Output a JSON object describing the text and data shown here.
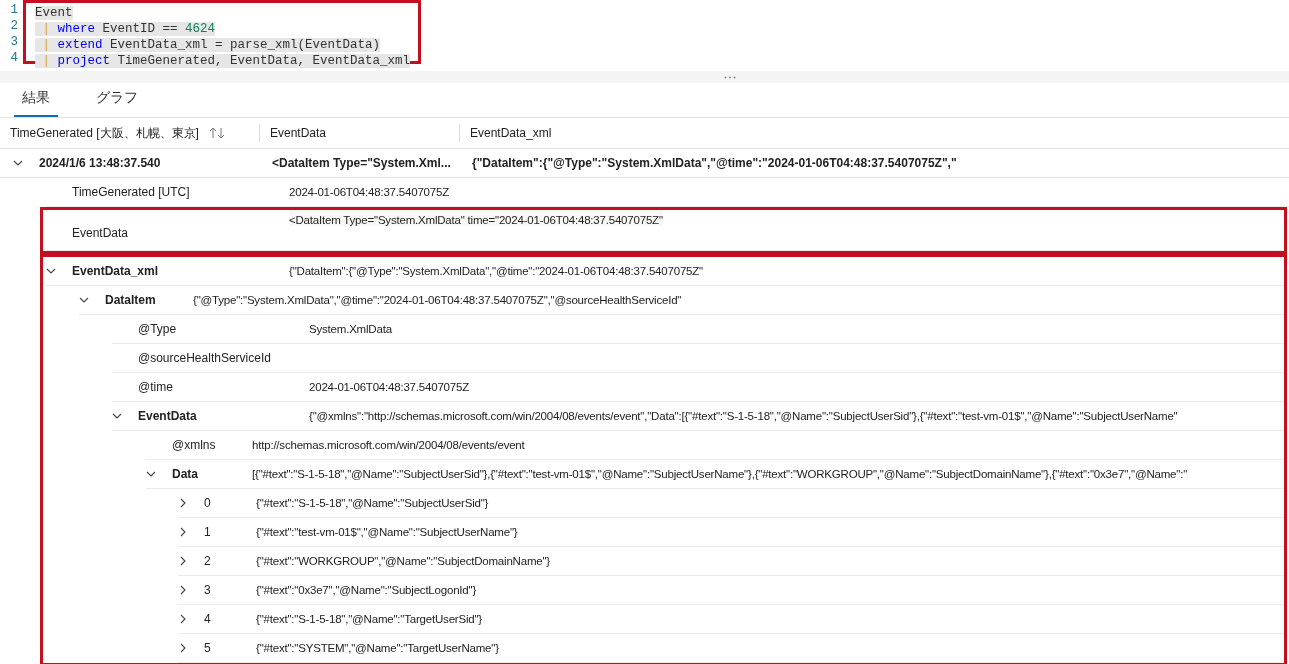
{
  "editor": {
    "highlighted": true,
    "lines": [
      {
        "number": "1",
        "tokens": [
          {
            "kind": "plain",
            "text": "Event"
          }
        ]
      },
      {
        "number": "2",
        "tokens": [
          {
            "kind": "pipe",
            "text": " | "
          },
          {
            "kind": "keyword",
            "text": "where"
          },
          {
            "kind": "plain",
            "text": " EventID == "
          },
          {
            "kind": "number",
            "text": "4624"
          }
        ]
      },
      {
        "number": "3",
        "tokens": [
          {
            "kind": "pipe",
            "text": " | "
          },
          {
            "kind": "keyword",
            "text": "extend"
          },
          {
            "kind": "plain",
            "text": " EventData_xml = parse_xml(EventData)"
          }
        ]
      },
      {
        "number": "4",
        "tokens": [
          {
            "kind": "pipe",
            "text": " | "
          },
          {
            "kind": "keyword",
            "text": "project"
          },
          {
            "kind": "plain",
            "text": " TimeGenerated, EventData, EventData_xml"
          }
        ]
      }
    ]
  },
  "tabs": [
    {
      "label": "結果",
      "selected": true
    },
    {
      "label": "グラフ",
      "selected": false
    }
  ],
  "table": {
    "columns": [
      {
        "label": "TimeGenerated [大阪、札幌、東京]",
        "sortable": true
      },
      {
        "label": "EventData",
        "sortable": false
      },
      {
        "label": "EventData_xml",
        "sortable": false
      }
    ],
    "rows": [
      {
        "expanded": true,
        "cells": [
          "2024/1/6 13:48:37.540",
          "<DataItem Type=\"System.Xml...",
          "{\"DataItem\":{\"@Type\":\"System.XmlData\",\"@time\":\"2024-01-06T04:48:37.5407075Z\",\""
        ],
        "details": [
          {
            "key": "TimeGenerated [UTC]",
            "value": "2024-01-06T04:48:37.5407075Z"
          },
          {
            "key": "EventData",
            "value": "<DataItem Type=\"System.XmlData\" time=\"2024-01-06T04:48:37.5407075Z\"",
            "highlighted": true
          },
          {
            "key": "EventData_xml",
            "value": "{\"DataItem\":{\"@Type\":\"System.XmlData\",\"@time\":\"2024-01-06T04:48:37.5407075Z\"",
            "highlighted": true,
            "expanded": true,
            "children": [
              {
                "key": "DataItem",
                "value": "{\"@Type\":\"System.XmlData\",\"@time\":\"2024-01-06T04:48:37.5407075Z\",\"@sourceHealthServiceId\"",
                "expanded": true,
                "children": [
                  {
                    "key": "@Type",
                    "value": "System.XmlData"
                  },
                  {
                    "key": "@sourceHealthServiceId"
                  },
                  {
                    "key": "@time",
                    "value": "2024-01-06T04:48:37.5407075Z"
                  },
                  {
                    "key": "EventData",
                    "value": "{\"@xmlns\":\"http://schemas.microsoft.com/win/2004/08/events/event\",\"Data\":[{\"#text\":\"S-1-5-18\",\"@Name\":\"SubjectUserSid\"},{\"#text\":\"test-vm-01$\",\"@Name\":\"SubjectUserName\"",
                    "expanded": true,
                    "children": [
                      {
                        "key": "@xmlns",
                        "value": "http://schemas.microsoft.com/win/2004/08/events/event"
                      },
                      {
                        "key": "Data",
                        "value": "[{\"#text\":\"S-1-5-18\",\"@Name\":\"SubjectUserSid\"},{\"#text\":\"test-vm-01$\",\"@Name\":\"SubjectUserName\"},{\"#text\":\"WORKGROUP\",\"@Name\":\"SubjectDomainName\"},{\"#text\":\"0x3e7\",\"@Name\":\"",
                        "expanded": true,
                        "children": [
                          {
                            "key": "0",
                            "value": "{\"#text\":\"S-1-5-18\",\"@Name\":\"SubjectUserSid\"}",
                            "expanded": false
                          },
                          {
                            "key": "1",
                            "value": "{\"#text\":\"test-vm-01$\",\"@Name\":\"SubjectUserName\"}",
                            "expanded": false
                          },
                          {
                            "key": "2",
                            "value": "{\"#text\":\"WORKGROUP\",\"@Name\":\"SubjectDomainName\"}",
                            "expanded": false
                          },
                          {
                            "key": "3",
                            "value": "{\"#text\":\"0x3e7\",\"@Name\":\"SubjectLogonId\"}",
                            "expanded": false
                          },
                          {
                            "key": "4",
                            "value": "{\"#text\":\"S-1-5-18\",\"@Name\":\"TargetUserSid\"}",
                            "expanded": false
                          },
                          {
                            "key": "5",
                            "value": "{\"#text\":\"SYSTEM\",\"@Name\":\"TargetUserName\"}",
                            "expanded": false
                          }
                        ]
                      }
                    ]
                  }
                ]
              }
            ]
          }
        ]
      }
    ]
  }
}
